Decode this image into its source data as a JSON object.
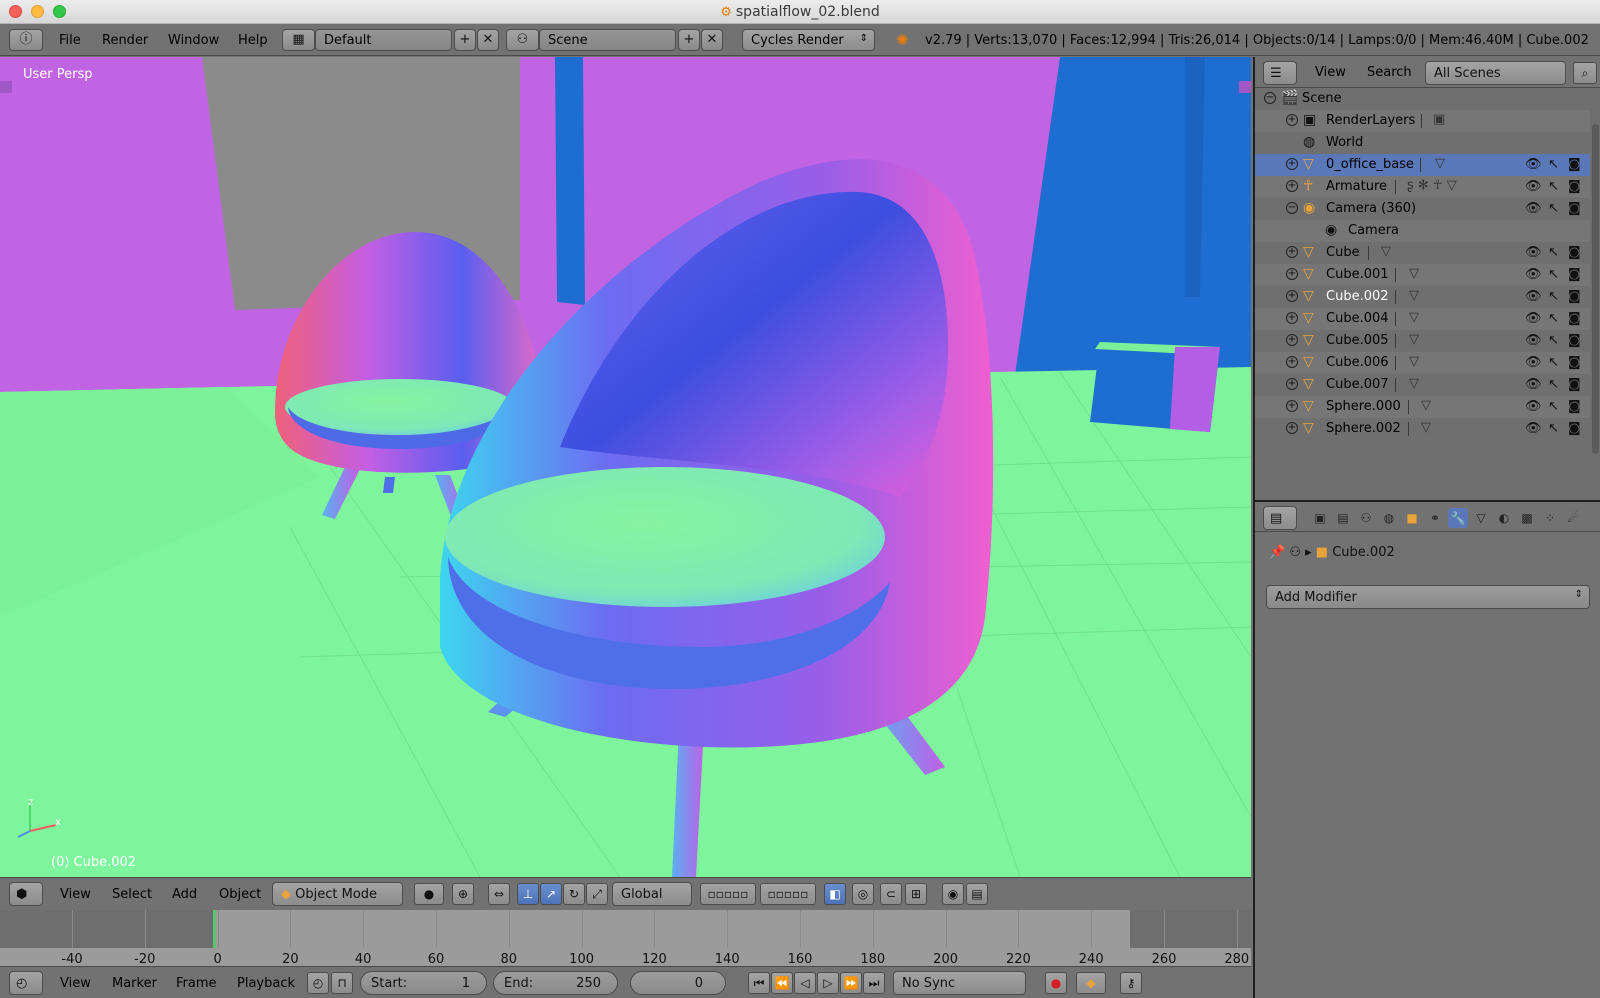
{
  "window": {
    "title": "spatialflow_02.blend"
  },
  "info_header": {
    "menus": [
      "File",
      "Render",
      "Window",
      "Help"
    ],
    "layout": "Default",
    "scene": "Scene",
    "engine": "Cycles Render",
    "stats": "v2.79 | Verts:13,070 | Faces:12,994 | Tris:26,014 | Objects:0/14 | Lamps:0/0 | Mem:46.40M | Cube.002"
  },
  "viewport": {
    "view_label": "User Persp",
    "object_label": "(0) Cube.002",
    "axis": {
      "x": "x",
      "z": "z"
    }
  },
  "view3d_header": {
    "menus": [
      "View",
      "Select",
      "Add",
      "Object"
    ],
    "mode": "Object Mode",
    "orientation": "Global"
  },
  "timeline": {
    "ticks": [
      "-40",
      "-20",
      "0",
      "20",
      "40",
      "60",
      "80",
      "100",
      "120",
      "140",
      "160",
      "180",
      "200",
      "220",
      "240",
      "260",
      "280"
    ],
    "menus": [
      "View",
      "Marker",
      "Frame",
      "Playback"
    ],
    "start_label": "Start:",
    "start_value": "1",
    "end_label": "End:",
    "end_value": "250",
    "current_frame": "0",
    "sync": "No Sync"
  },
  "outliner": {
    "menus": [
      "View",
      "Search"
    ],
    "scene_filter": "All Scenes",
    "items": [
      {
        "name": "Scene"
      },
      {
        "name": "RenderLayers"
      },
      {
        "name": "World"
      },
      {
        "name": "0_office_base"
      },
      {
        "name": "Armature"
      },
      {
        "name": "Camera (360)"
      },
      {
        "name": "Camera"
      },
      {
        "name": "Cube"
      },
      {
        "name": "Cube.001"
      },
      {
        "name": "Cube.002"
      },
      {
        "name": "Cube.004"
      },
      {
        "name": "Cube.005"
      },
      {
        "name": "Cube.006"
      },
      {
        "name": "Cube.007"
      },
      {
        "name": "Sphere.000"
      },
      {
        "name": "Sphere.002"
      }
    ]
  },
  "properties": {
    "object": "Cube.002",
    "add_modifier": "Add Modifier"
  },
  "colors": {
    "floor": "#7ef59d",
    "walls": "#c164e4",
    "accent": "#5a78b8",
    "panel": "#727272"
  }
}
